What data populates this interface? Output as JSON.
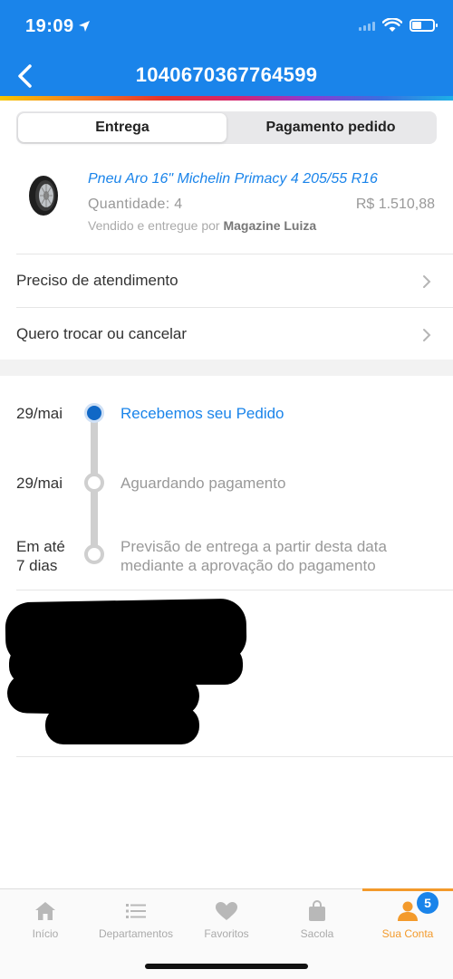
{
  "status_bar": {
    "time": "19:09"
  },
  "header": {
    "title": "1040670367764599"
  },
  "tabs": [
    {
      "label": "Entrega",
      "active": true
    },
    {
      "label": "Pagamento pedido",
      "active": false
    }
  ],
  "product": {
    "name": "Pneu Aro 16\" Michelin Primacy 4 205/55 R16",
    "quantity": "Quantidade: 4",
    "price": "R$ 1.510,88",
    "seller_prefix": "Vendido e entregue por",
    "seller_name": "Magazine Luiza"
  },
  "menu": [
    {
      "label": "Preciso de atendimento"
    },
    {
      "label": "Quero trocar ou cancelar"
    }
  ],
  "timeline": [
    {
      "date": "29/mai",
      "text": "Recebemos seu Pedido",
      "status": "done"
    },
    {
      "date": "29/mai",
      "text": "Aguardando pagamento",
      "status": "pending"
    },
    {
      "date_line1": "Em até",
      "date_line2": "7 dias",
      "text_line1": "Previsão de entrega a partir desta data",
      "text_line2": "mediante a aprovação do pagamento",
      "status": "pending"
    }
  ],
  "bottom_nav": {
    "items": [
      {
        "label": "Início",
        "icon": "home-icon"
      },
      {
        "label": "Departamentos",
        "icon": "list-icon"
      },
      {
        "label": "Favoritos",
        "icon": "heart-icon"
      },
      {
        "label": "Sacola",
        "icon": "bag-icon"
      },
      {
        "label": "Sua Conta",
        "icon": "user-icon",
        "active": true
      }
    ],
    "badge": "5"
  },
  "colors": {
    "brand_blue": "#1a84ea",
    "accent_orange": "#f39a2b",
    "timeline_active": "#1068c6"
  }
}
